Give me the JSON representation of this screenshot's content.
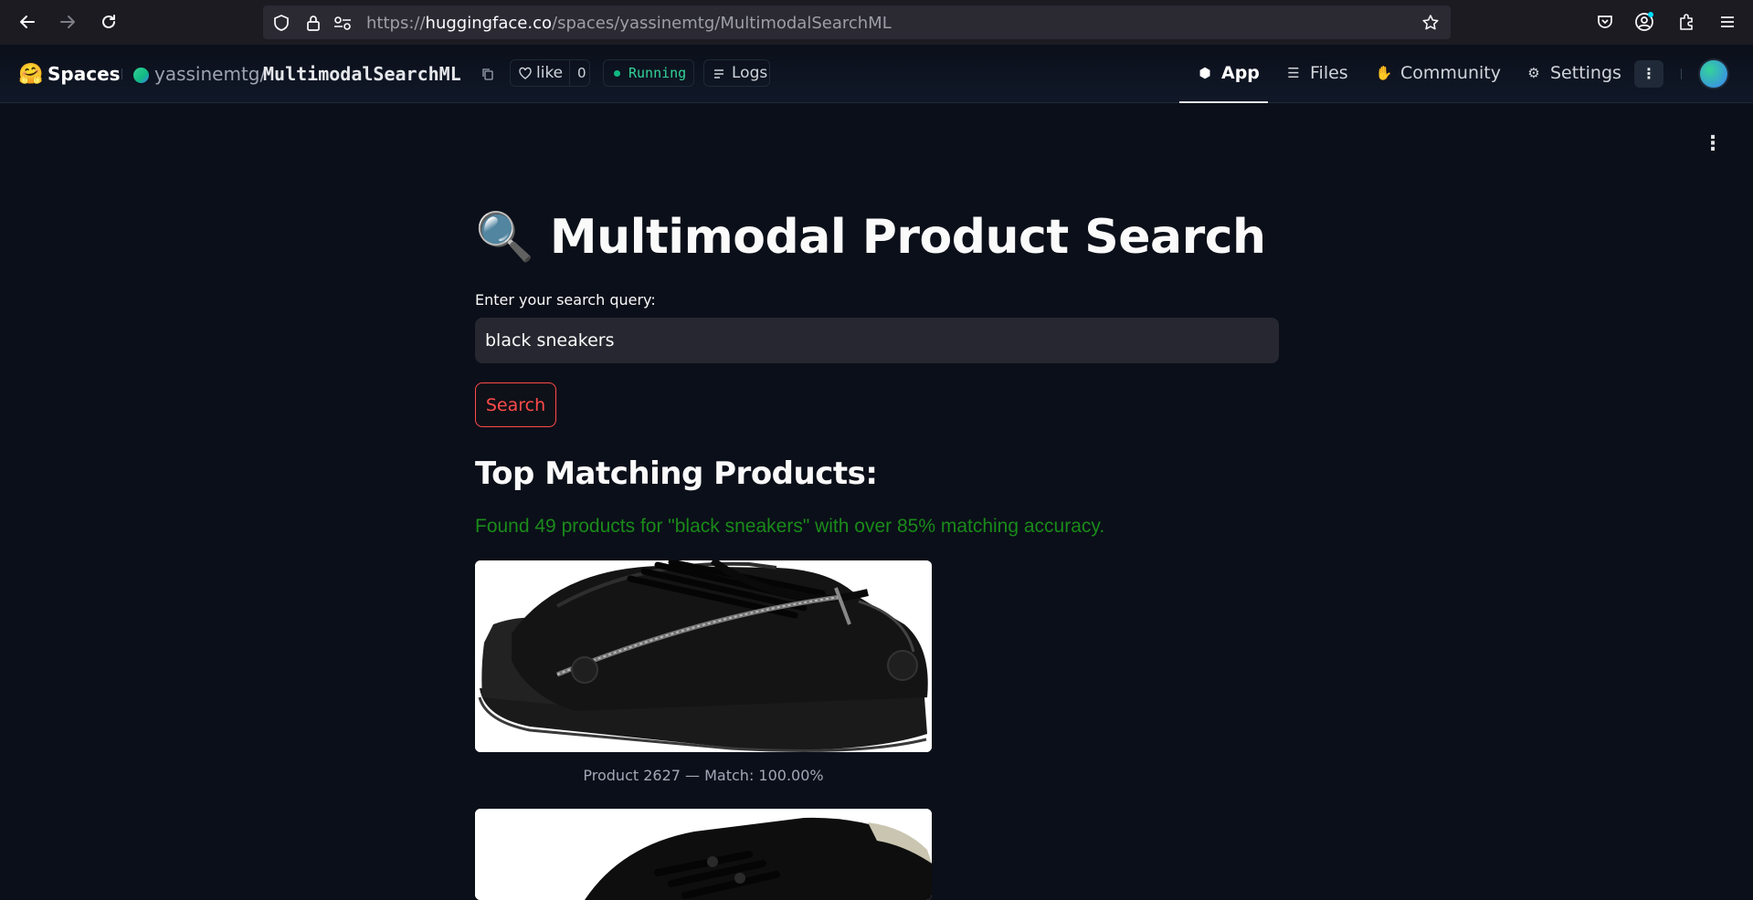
{
  "browser": {
    "url_prefix": "https://",
    "url_host": "huggingface.co",
    "url_path": "/spaces/yassinemtg/MultimodalSearchML"
  },
  "hf_header": {
    "logo": "🤗",
    "spaces_label": "Spaces",
    "owner": "yassinemtg/",
    "space_name": "MultimodalSearchML",
    "like_label": "like",
    "like_count": "0",
    "status": "Running",
    "logs_label": "Logs",
    "tabs": [
      {
        "label": "App",
        "icon": "cube-icon"
      },
      {
        "label": "Files",
        "icon": "files-icon"
      },
      {
        "label": "Community",
        "icon": "community-icon"
      },
      {
        "label": "Settings",
        "icon": "gear-icon"
      }
    ],
    "more_label": "⋮"
  },
  "app": {
    "title": "🔍 Multimodal Product Search",
    "query_label": "Enter your search query:",
    "query_value": "black sneakers",
    "search_button": "Search",
    "results_heading": "Top Matching Products:",
    "found_text": "Found 49 products for \"black sneakers\" with over 85% matching accuracy.",
    "products": [
      {
        "caption": "Product 2627 — Match: 100.00%"
      },
      {
        "caption": ""
      }
    ]
  },
  "colors": {
    "accent": "#ff4b4b",
    "success_text": "#1a8a1a",
    "background": "#0b0f19",
    "running": "#34d399"
  }
}
